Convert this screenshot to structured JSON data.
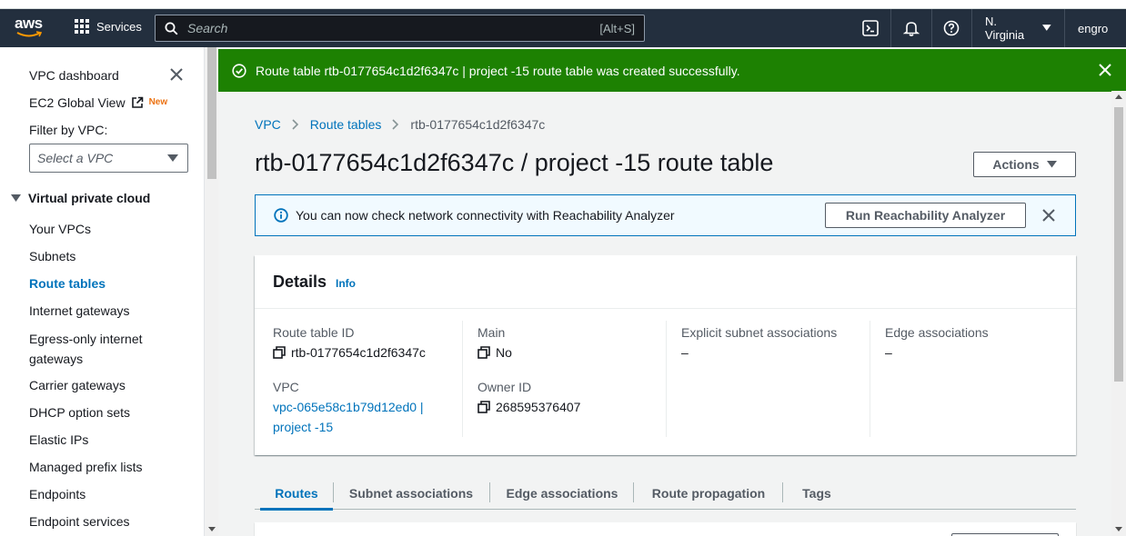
{
  "topnav": {
    "logo_text": "aws",
    "services_label": "Services",
    "search_placeholder": "Search",
    "search_shortcut": "[Alt+S]",
    "region": "N. Virginia",
    "account": "engro"
  },
  "sidebar": {
    "dashboard": "VPC dashboard",
    "ec2_global_view": "EC2 Global View",
    "new_badge": "New",
    "filter_label": "Filter by VPC:",
    "vpc_select_placeholder": "Select a VPC",
    "section_title": "Virtual private cloud",
    "items": [
      {
        "label": "Your VPCs"
      },
      {
        "label": "Subnets"
      },
      {
        "label": "Route tables",
        "active": true
      },
      {
        "label": "Internet gateways"
      },
      {
        "label": "Egress-only internet gateways"
      },
      {
        "label": "Carrier gateways"
      },
      {
        "label": "DHCP option sets"
      },
      {
        "label": "Elastic IPs"
      },
      {
        "label": "Managed prefix lists"
      },
      {
        "label": "Endpoints"
      },
      {
        "label": "Endpoint services"
      }
    ]
  },
  "flash": {
    "message": "Route table rtb-0177654c1d2f6347c | project -15 route table was created successfully.",
    "type": "success"
  },
  "breadcrumb": [
    "VPC",
    "Route tables",
    "rtb-0177654c1d2f6347c"
  ],
  "page_title": "rtb-0177654c1d2f6347c / project -15 route table",
  "actions_label": "Actions",
  "info_banner": {
    "message": "You can now check network connectivity with Reachability Analyzer",
    "button": "Run Reachability Analyzer"
  },
  "details": {
    "title": "Details",
    "info_link": "Info",
    "route_table_id_label": "Route table ID",
    "route_table_id": "rtb-0177654c1d2f6347c",
    "main_label": "Main",
    "main_value": "No",
    "explicit_subnet_label": "Explicit subnet associations",
    "explicit_subnet_value": "–",
    "edge_assoc_label": "Edge associations",
    "edge_assoc_value": "–",
    "vpc_label": "VPC",
    "vpc_value": "vpc-065e58c1b79d12ed0 | project -15",
    "owner_label": "Owner ID",
    "owner_value": "268595376407"
  },
  "tabs": [
    {
      "label": "Routes",
      "active": true
    },
    {
      "label": "Subnet associations"
    },
    {
      "label": "Edge associations"
    },
    {
      "label": "Route propagation"
    },
    {
      "label": "Tags"
    }
  ],
  "colors": {
    "nav_bg": "#232f3e",
    "success_green": "#1d8102",
    "link_blue": "#0073bb",
    "info_bg": "#f1faff"
  }
}
